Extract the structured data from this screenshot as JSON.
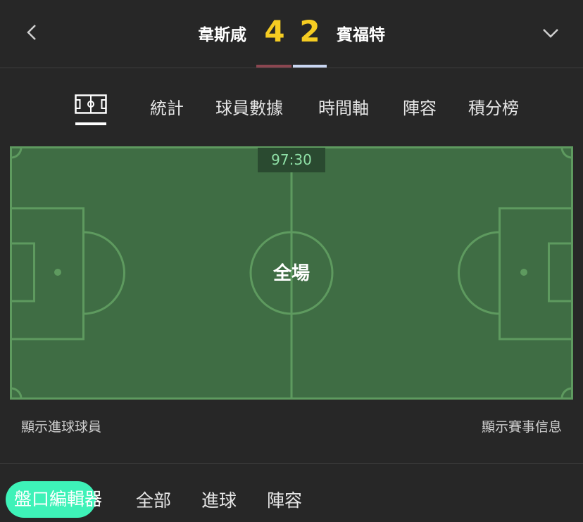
{
  "header": {
    "home_team": "韋斯咸",
    "away_team": "賓福特",
    "home_score": "4",
    "away_score": "2",
    "home_color": "#8b4650",
    "away_color": "#c9d6f2",
    "score_color": "#f5cc22",
    "back_icon": "chevron-left",
    "expand_icon": "chevron-down"
  },
  "tabs": {
    "pitch_icon": "pitch-icon",
    "items": [
      "統計",
      "球員數據",
      "時間軸",
      "陣容",
      "積分榜"
    ]
  },
  "pitch": {
    "timer": "97:30",
    "period": "全場",
    "grass_color": "#3f6d44",
    "line_color": "#5e9a5f"
  },
  "options": {
    "show_scorers": "顯示進球球員",
    "show_match_info": "顯示賽事信息"
  },
  "filters": {
    "editor": "盤口編輯器",
    "items": [
      "全部",
      "進球",
      "陣容"
    ],
    "editor_color": "#3ef2b8"
  }
}
